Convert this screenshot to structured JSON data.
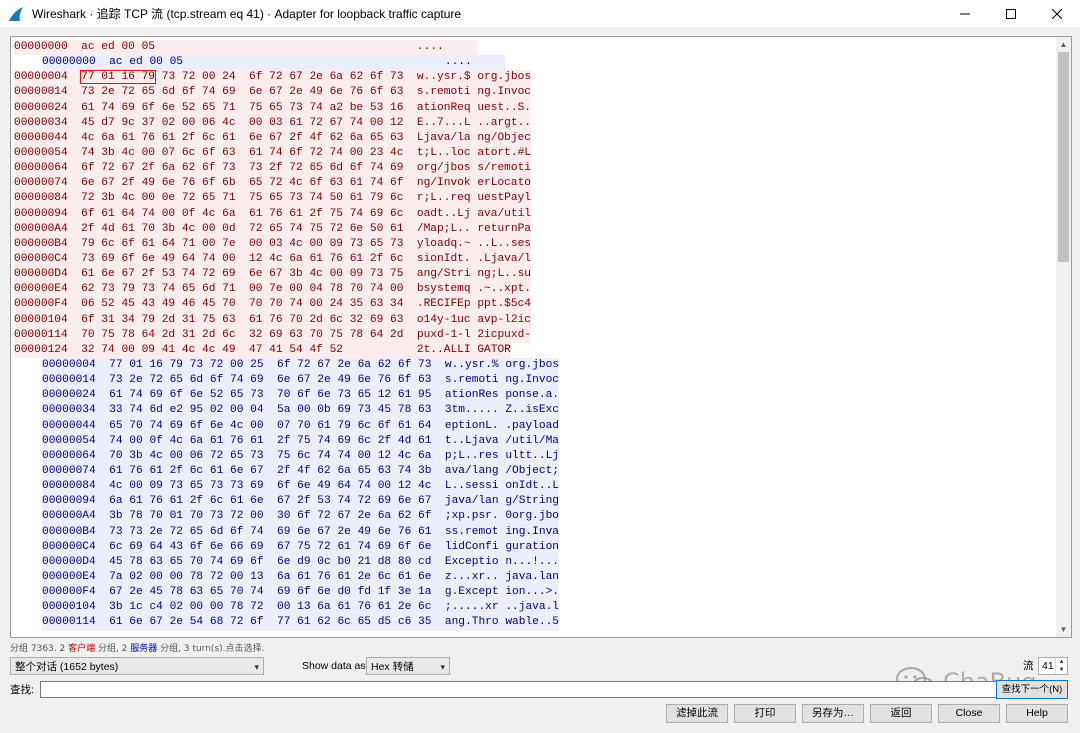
{
  "window": {
    "title": "Wireshark · 追踪 TCP 流 (tcp.stream eq 41) · Adapter for loopback traffic capture"
  },
  "hex_lines": [
    {
      "dir": "client",
      "offset": "00000000",
      "hex1": "ac ed 00 05",
      "hex2": "",
      "ascii1": "....",
      "ascii2": ""
    },
    {
      "dir": "server",
      "offset": "00000000",
      "hex1": "ac ed 00 05",
      "hex2": "",
      "ascii1": "....",
      "ascii2": ""
    },
    {
      "dir": "client",
      "offset": "00000004",
      "hex1": "77 01 16 79 73 72 00 24",
      "hex2": "6f 72 67 2e 6a 62 6f 73",
      "ascii1": "w..ysr.$",
      "ascii2": "org.jbos",
      "highlight": "77 01 16 79"
    },
    {
      "dir": "client",
      "offset": "00000014",
      "hex1": "73 2e 72 65 6d 6f 74 69",
      "hex2": "6e 67 2e 49 6e 76 6f 63",
      "ascii1": "s.remoti",
      "ascii2": "ng.Invoc"
    },
    {
      "dir": "client",
      "offset": "00000024",
      "hex1": "61 74 69 6f 6e 52 65 71",
      "hex2": "75 65 73 74 a2 be 53 16",
      "ascii1": "ationReq",
      "ascii2": "uest..S."
    },
    {
      "dir": "client",
      "offset": "00000034",
      "hex1": "45 d7 9c 37 02 00 06 4c",
      "hex2": "00 03 61 72 67 74 00 12",
      "ascii1": "E..7...L",
      "ascii2": "..argt.."
    },
    {
      "dir": "client",
      "offset": "00000044",
      "hex1": "4c 6a 61 76 61 2f 6c 61",
      "hex2": "6e 67 2f 4f 62 6a 65 63",
      "ascii1": "Ljava/la",
      "ascii2": "ng/Objec"
    },
    {
      "dir": "client",
      "offset": "00000054",
      "hex1": "74 3b 4c 00 07 6c 6f 63",
      "hex2": "61 74 6f 72 74 00 23 4c",
      "ascii1": "t;L..loc",
      "ascii2": "atort.#L"
    },
    {
      "dir": "client",
      "offset": "00000064",
      "hex1": "6f 72 67 2f 6a 62 6f 73",
      "hex2": "73 2f 72 65 6d 6f 74 69",
      "ascii1": "org/jbos",
      "ascii2": "s/remoti"
    },
    {
      "dir": "client",
      "offset": "00000074",
      "hex1": "6e 67 2f 49 6e 76 6f 6b",
      "hex2": "65 72 4c 6f 63 61 74 6f",
      "ascii1": "ng/Invok",
      "ascii2": "erLocato"
    },
    {
      "dir": "client",
      "offset": "00000084",
      "hex1": "72 3b 4c 00 0e 72 65 71",
      "hex2": "75 65 73 74 50 61 79 6c",
      "ascii1": "r;L..req",
      "ascii2": "uestPayl"
    },
    {
      "dir": "client",
      "offset": "00000094",
      "hex1": "6f 61 64 74 00 0f 4c 6a",
      "hex2": "61 76 61 2f 75 74 69 6c",
      "ascii1": "oadt..Lj",
      "ascii2": "ava/util"
    },
    {
      "dir": "client",
      "offset": "000000A4",
      "hex1": "2f 4d 61 70 3b 4c 00 0d",
      "hex2": "72 65 74 75 72 6e 50 61",
      "ascii1": "/Map;L..",
      "ascii2": "returnPa"
    },
    {
      "dir": "client",
      "offset": "000000B4",
      "hex1": "79 6c 6f 61 64 71 00 7e",
      "hex2": "00 03 4c 00 09 73 65 73",
      "ascii1": "yloadq.~",
      "ascii2": "..L..ses"
    },
    {
      "dir": "client",
      "offset": "000000C4",
      "hex1": "73 69 6f 6e 49 64 74 00",
      "hex2": "12 4c 6a 61 76 61 2f 6c",
      "ascii1": "sionIdt.",
      "ascii2": ".Ljava/l"
    },
    {
      "dir": "client",
      "offset": "000000D4",
      "hex1": "61 6e 67 2f 53 74 72 69",
      "hex2": "6e 67 3b 4c 00 09 73 75",
      "ascii1": "ang/Stri",
      "ascii2": "ng;L..su"
    },
    {
      "dir": "client",
      "offset": "000000E4",
      "hex1": "62 73 79 73 74 65 6d 71",
      "hex2": "00 7e 00 04 78 70 74 00",
      "ascii1": "bsystemq",
      "ascii2": ".~..xpt."
    },
    {
      "dir": "client",
      "offset": "000000F4",
      "hex1": "06 52 45 43 49 46 45 70",
      "hex2": "70 70 74 00 24 35 63 34",
      "ascii1": ".RECIFEp",
      "ascii2": "ppt.$5c4"
    },
    {
      "dir": "client",
      "offset": "00000104",
      "hex1": "6f 31 34 79 2d 31 75 63",
      "hex2": "61 76 70 2d 6c 32 69 63",
      "ascii1": "o14y-1uc",
      "ascii2": "avp-l2ic"
    },
    {
      "dir": "client",
      "offset": "00000114",
      "hex1": "70 75 78 64 2d 31 2d 6c",
      "hex2": "32 69 63 70 75 78 64 2d",
      "ascii1": "puxd-1-l",
      "ascii2": "2icpuxd-"
    },
    {
      "dir": "client",
      "offset": "00000124",
      "hex1": "32 74 00 09 41 4c 4c 49",
      "hex2": "47 41 54 4f 52",
      "ascii1": "2t..ALLI",
      "ascii2": "GATOR"
    },
    {
      "dir": "server",
      "offset": "00000004",
      "hex1": "77 01 16 79 73 72 00 25",
      "hex2": "6f 72 67 2e 6a 62 6f 73",
      "ascii1": "w..ysr.%",
      "ascii2": "org.jbos"
    },
    {
      "dir": "server",
      "offset": "00000014",
      "hex1": "73 2e 72 65 6d 6f 74 69",
      "hex2": "6e 67 2e 49 6e 76 6f 63",
      "ascii1": "s.remoti",
      "ascii2": "ng.Invoc"
    },
    {
      "dir": "server",
      "offset": "00000024",
      "hex1": "61 74 69 6f 6e 52 65 73",
      "hex2": "70 6f 6e 73 65 12 61 95",
      "ascii1": "ationRes",
      "ascii2": "ponse.a."
    },
    {
      "dir": "server",
      "offset": "00000034",
      "hex1": "33 74 6d e2 95 02 00 04",
      "hex2": "5a 00 0b 69 73 45 78 63",
      "ascii1": "3tm.....",
      "ascii2": "Z..isExc"
    },
    {
      "dir": "server",
      "offset": "00000044",
      "hex1": "65 70 74 69 6f 6e 4c 00",
      "hex2": "07 70 61 79 6c 6f 61 64",
      "ascii1": "eptionL.",
      "ascii2": ".payload"
    },
    {
      "dir": "server",
      "offset": "00000054",
      "hex1": "74 00 0f 4c 6a 61 76 61",
      "hex2": "2f 75 74 69 6c 2f 4d 61",
      "ascii1": "t..Ljava",
      "ascii2": "/util/Ma"
    },
    {
      "dir": "server",
      "offset": "00000064",
      "hex1": "70 3b 4c 00 06 72 65 73",
      "hex2": "75 6c 74 74 00 12 4c 6a",
      "ascii1": "p;L..res",
      "ascii2": "ultt..Lj"
    },
    {
      "dir": "server",
      "offset": "00000074",
      "hex1": "61 76 61 2f 6c 61 6e 67",
      "hex2": "2f 4f 62 6a 65 63 74 3b",
      "ascii1": "ava/lang",
      "ascii2": "/Object;"
    },
    {
      "dir": "server",
      "offset": "00000084",
      "hex1": "4c 00 09 73 65 73 73 69",
      "hex2": "6f 6e 49 64 74 00 12 4c",
      "ascii1": "L..sessi",
      "ascii2": "onIdt..L"
    },
    {
      "dir": "server",
      "offset": "00000094",
      "hex1": "6a 61 76 61 2f 6c 61 6e",
      "hex2": "67 2f 53 74 72 69 6e 67",
      "ascii1": "java/lan",
      "ascii2": "g/String"
    },
    {
      "dir": "server",
      "offset": "000000A4",
      "hex1": "3b 78 70 01 70 73 72 00",
      "hex2": "30 6f 72 67 2e 6a 62 6f",
      "ascii1": ";xp.psr.",
      "ascii2": "0org.jbo"
    },
    {
      "dir": "server",
      "offset": "000000B4",
      "hex1": "73 73 2e 72 65 6d 6f 74",
      "hex2": "69 6e 67 2e 49 6e 76 61",
      "ascii1": "ss.remot",
      "ascii2": "ing.Inva"
    },
    {
      "dir": "server",
      "offset": "000000C4",
      "hex1": "6c 69 64 43 6f 6e 66 69",
      "hex2": "67 75 72 61 74 69 6f 6e",
      "ascii1": "lidConfi",
      "ascii2": "guration"
    },
    {
      "dir": "server",
      "offset": "000000D4",
      "hex1": "45 78 63 65 70 74 69 6f",
      "hex2": "6e d9 0c b0 21 d8 80 cd",
      "ascii1": "Exceptio",
      "ascii2": "n...!..."
    },
    {
      "dir": "server",
      "offset": "000000E4",
      "hex1": "7a 02 00 00 78 72 00 13",
      "hex2": "6a 61 76 61 2e 6c 61 6e",
      "ascii1": "z...xr..",
      "ascii2": "java.lan"
    },
    {
      "dir": "server",
      "offset": "000000F4",
      "hex1": "67 2e 45 78 63 65 70 74",
      "hex2": "69 6f 6e d0 fd 1f 3e 1a",
      "ascii1": "g.Except",
      "ascii2": "ion...>."
    },
    {
      "dir": "server",
      "offset": "00000104",
      "hex1": "3b 1c c4 02 00 00 78 72",
      "hex2": "00 13 6a 61 76 61 2e 6c",
      "ascii1": ";.....xr",
      "ascii2": "..java.l"
    },
    {
      "dir": "server",
      "offset": "00000114",
      "hex1": "61 6e 67 2e 54 68 72 6f",
      "hex2": "77 61 62 6c 65 d5 c6 35",
      "ascii1": "ang.Thro",
      "ascii2": "wable..5"
    }
  ],
  "summary": {
    "part1": "分组 7363. 2 ",
    "client": "客户端",
    "part2": " 分组, 2 ",
    "server": "服务器",
    "part3": " 分组, 3 turn(s).点击选择."
  },
  "conversation_select": {
    "value": "整个对话 (1652 bytes)"
  },
  "show_data_label": "Show data as",
  "show_data_select": {
    "value": "Hex 转储"
  },
  "stream_label": "流",
  "stream_value": "41",
  "find": {
    "label": "查找:",
    "value": ""
  },
  "buttons": {
    "find_next": "查找下一个(N)",
    "filter_out": "滤掉此流",
    "print": "打印",
    "save_as": "另存为…",
    "back": "返回",
    "close": "Close",
    "help": "Help"
  },
  "watermark": {
    "text": "ChaBug"
  },
  "colors": {
    "client_bg": "#fbedee",
    "client_fg": "#7f0000",
    "server_bg": "#edeefb",
    "server_fg": "#00007f",
    "highlight": "#ee1111"
  }
}
